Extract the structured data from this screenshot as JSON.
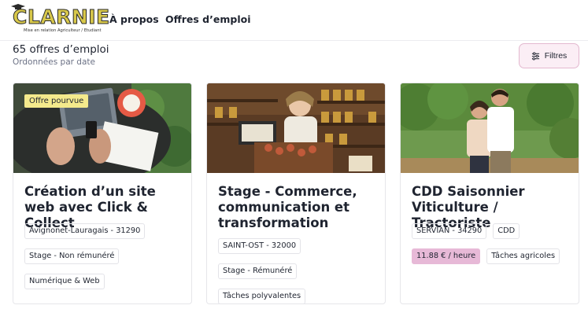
{
  "brand": {
    "name": "CLARNIE",
    "tagline": "Mise en relation Agriculteur / Etudiant"
  },
  "nav": {
    "about": "À propos",
    "jobs": "Offres d’emploi"
  },
  "summary": {
    "count": "65 offres d’emploi",
    "sort": "Ordonnées par date",
    "filter_label": "Filtres"
  },
  "colors": {
    "accent_pink": "#e7b9d7",
    "badge_yellow": "#f4ea8c",
    "filter_bg": "#fbeef5"
  },
  "offers": [
    {
      "badge": "Offre pourvue",
      "title": "Création d’un site web avec Click & Collect",
      "location": "Avignonet-Lauragais - 31290",
      "contract": "Stage - Non rémunéré",
      "category": "Numérique & Web"
    },
    {
      "title": "Stage - Commerce, communication et transformation",
      "location": "SAINT-OST - 32000",
      "contract": "Stage - Rémunéré",
      "category": "Tâches polyvalentes"
    },
    {
      "title": "CDD Saisonnier Viticulture / Tractoriste",
      "location": "SERVIAN - 34290",
      "contract": "CDD",
      "pay": "11.88 € / heure",
      "category": "Tâches agricoles"
    }
  ]
}
